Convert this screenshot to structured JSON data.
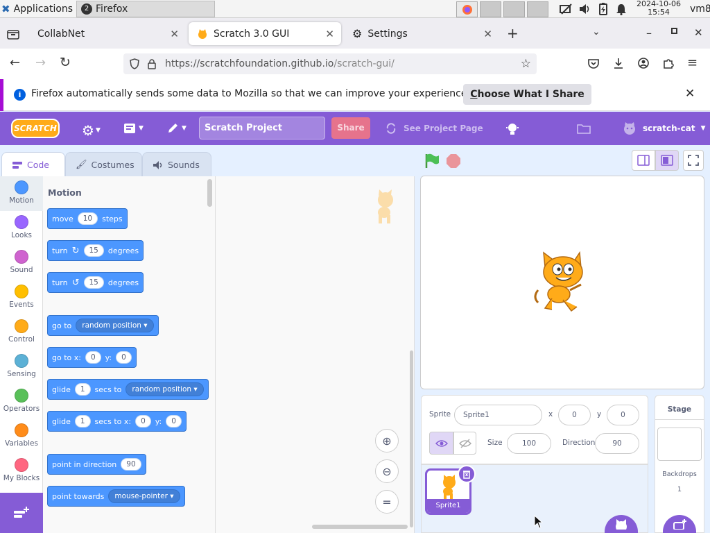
{
  "taskbar": {
    "apps_label": "Applications",
    "firefox_badge": "2",
    "firefox_label": "Firefox",
    "date": "2024-10-06",
    "time": "15:54",
    "host": "vm8"
  },
  "browser": {
    "tabs": [
      {
        "label": "CollabNet"
      },
      {
        "label": "Scratch 3.0 GUI"
      },
      {
        "label": "Settings"
      }
    ],
    "new_tab": "+",
    "url_domain": "https://scratchfoundation.github.io",
    "url_path": "/scratch-gui/",
    "notice_text": "Firefox automatically sends some data to Mozilla so that we can improve your experience.",
    "notice_button_first": "C",
    "notice_button_rest": "hoose What I Share"
  },
  "scratch": {
    "logo": "SCRATCH",
    "project_title": "Scratch Project",
    "share_label": "Share",
    "see_project_label": "See Project Page",
    "username": "scratch-cat",
    "editor_tabs": {
      "code": "Code",
      "costumes": "Costumes",
      "sounds": "Sounds"
    },
    "categories": [
      {
        "label": "Motion",
        "color": "#4c97ff"
      },
      {
        "label": "Looks",
        "color": "#9966ff"
      },
      {
        "label": "Sound",
        "color": "#cf63cf"
      },
      {
        "label": "Events",
        "color": "#ffbf00"
      },
      {
        "label": "Control",
        "color": "#ffab19"
      },
      {
        "label": "Sensing",
        "color": "#5cb1d6"
      },
      {
        "label": "Operators",
        "color": "#59c059"
      },
      {
        "label": "Variables",
        "color": "#ff8c1a"
      },
      {
        "label": "My Blocks",
        "color": "#ff6680"
      }
    ],
    "palette_heading": "Motion",
    "blocks": {
      "move": {
        "a": "move",
        "v": "10",
        "b": "steps"
      },
      "turn_right": {
        "a": "turn",
        "v": "15",
        "b": "degrees"
      },
      "turn_left": {
        "a": "turn",
        "v": "15",
        "b": "degrees"
      },
      "goto": {
        "a": "go to",
        "dd": "random position"
      },
      "goto_xy": {
        "a": "go to x:",
        "x": "0",
        "ylab": "y:",
        "y": "0"
      },
      "glide_to": {
        "a": "glide",
        "v": "1",
        "b": "secs to",
        "dd": "random position"
      },
      "glide_xy": {
        "a": "glide",
        "v": "1",
        "b": "secs to x:",
        "x": "0",
        "ylab": "y:",
        "y": "0"
      },
      "point_dir": {
        "a": "point in direction",
        "v": "90"
      },
      "point_towards": {
        "a": "point towards",
        "dd": "mouse-pointer"
      }
    },
    "sprite_info": {
      "sprite_label": "Sprite",
      "sprite_name": "Sprite1",
      "x_label": "x",
      "x": "0",
      "y_label": "y",
      "y": "0",
      "size_label": "Size",
      "size": "100",
      "direction_label": "Direction",
      "direction": "90"
    },
    "sprite_thumb_label": "Sprite1",
    "stage_pane": {
      "title": "Stage",
      "backdrops_label": "Backdrops",
      "backdrops_count": "1"
    }
  }
}
